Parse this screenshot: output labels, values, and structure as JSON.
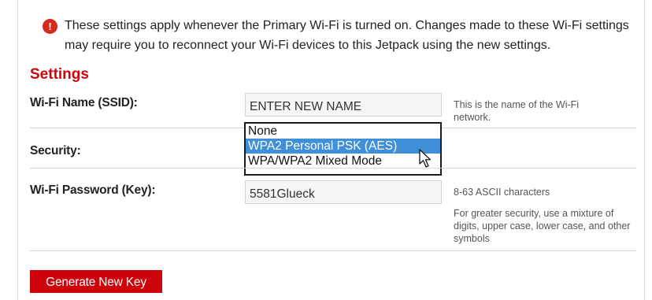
{
  "notice": {
    "icon": "info-icon",
    "text": "These settings apply whenever the Primary Wi-Fi is turned on. Changes made to these Wi-Fi settings may require you to reconnect your Wi-Fi devices to this Jetpack using the new settings."
  },
  "settings": {
    "title": "Settings",
    "ssid": {
      "label": "Wi-Fi Name (SSID):",
      "value": "ENTER NEW NAME",
      "help": "This is the name of the Wi-Fi network."
    },
    "security": {
      "label": "Security:",
      "options": [
        "None",
        "WPA2 Personal PSK (AES)",
        "WPA/WPA2 Mixed Mode"
      ],
      "highlighted": "WPA2 Personal PSK (AES)"
    },
    "password": {
      "label": "Wi-Fi Password (Key):",
      "value": "5581Glueck",
      "help1": "8-63 ASCII characters",
      "help2": "For greater security, use a mixture of digits, upper case, lower case, and other symbols"
    },
    "generate_button": "Generate New Key"
  },
  "colors": {
    "accent": "#cd040b",
    "selection": "#3f8fd9"
  }
}
